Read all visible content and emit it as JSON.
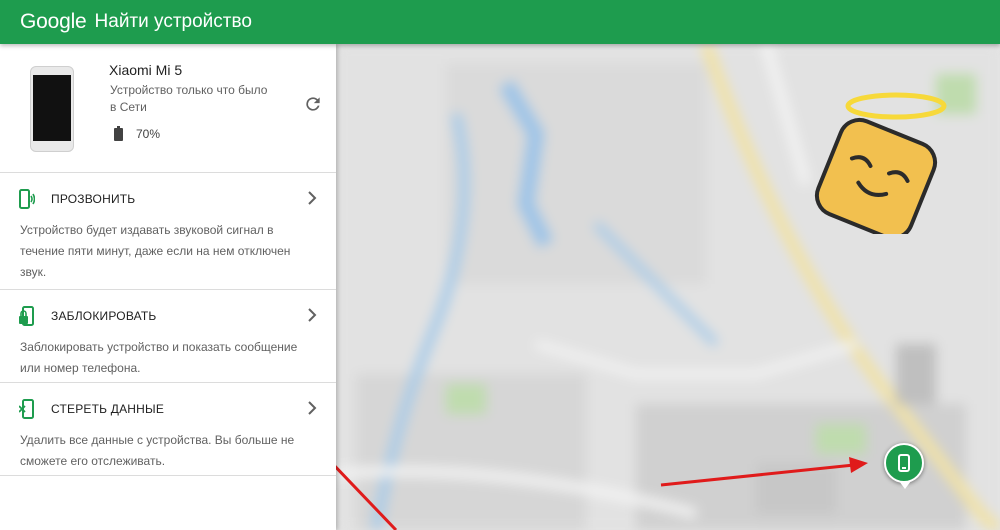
{
  "header": {
    "brand": "Google",
    "title": "Найти устройство"
  },
  "device": {
    "name": "Xiaomi Mi 5",
    "status": "Устройство только что было в Сети",
    "battery": "70%",
    "refresh_icon": "refresh-icon"
  },
  "actions": [
    {
      "icon": "ring-phone-icon",
      "title": "ПРОЗВОНИТЬ",
      "desc": "Устройство будет издавать звуковой сигнал в течение пяти минут, даже если на нем отключен звук."
    },
    {
      "icon": "lock-phone-icon",
      "title": "ЗАБЛОКИРОВАТЬ",
      "desc": "Заблокировать устройство и показать сообщение или номер телефона."
    },
    {
      "icon": "erase-phone-icon",
      "title": "СТЕРЕТЬ ДАННЫЕ",
      "desc": "Удалить все данные с устройства. Вы больше не сможете его отслеживать."
    }
  ],
  "map": {
    "marker_icon": "device-location-marker",
    "sticker": "angel-mascot"
  },
  "colors": {
    "accent": "#1e9c4e",
    "arrow": "#e01b1b"
  }
}
